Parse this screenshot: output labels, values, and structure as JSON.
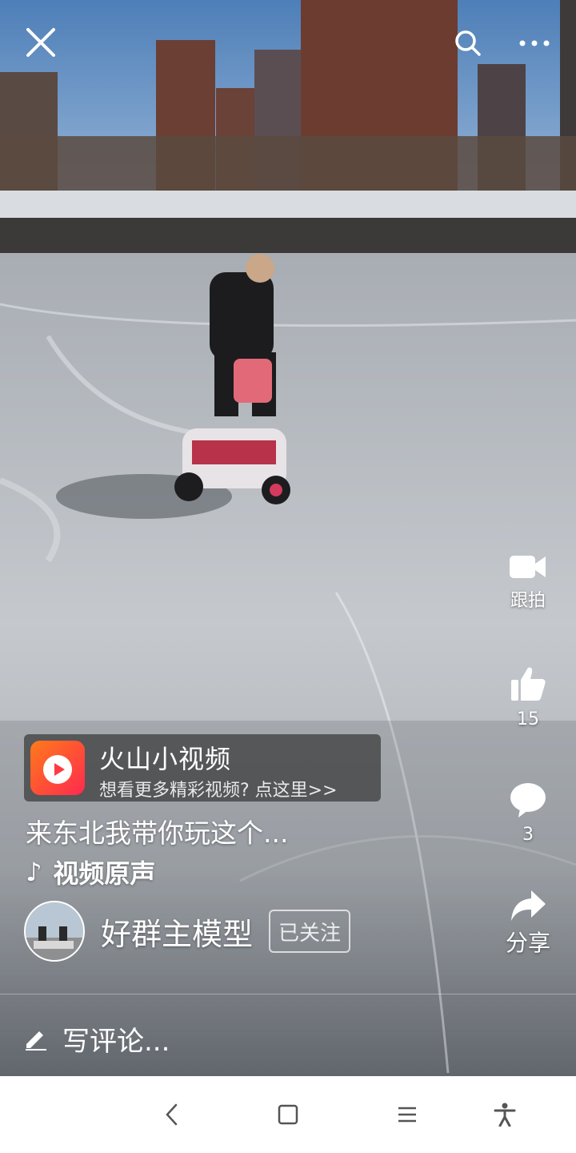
{
  "topbar": {
    "close_icon": "close-icon",
    "search_icon": "search-icon",
    "more_icon": "more-dots-icon"
  },
  "actions": {
    "follow_shoot": {
      "icon": "video-camera-icon",
      "label": "跟拍"
    },
    "like": {
      "icon": "thumbs-up-icon",
      "count": "15"
    },
    "comment": {
      "icon": "comment-bubble-icon",
      "count": "3"
    },
    "share": {
      "icon": "share-arrow-icon",
      "label": "分享"
    }
  },
  "banner": {
    "title": "火山小视频",
    "subtitle": "想看更多精彩视频? 点这里>>",
    "brand_colors": [
      "#ff7a1a",
      "#ff2a4f"
    ]
  },
  "video": {
    "caption": "来东北我带你玩这个...",
    "music": "视频原声"
  },
  "author": {
    "name": "好群主模型",
    "follow_status": "已关注"
  },
  "comment_input": {
    "placeholder": "写评论..."
  },
  "navbar": {
    "back_icon": "back-chevron-icon",
    "home_icon": "home-square-icon",
    "menu_icon": "menu-lines-icon",
    "accessibility_icon": "accessibility-icon"
  }
}
